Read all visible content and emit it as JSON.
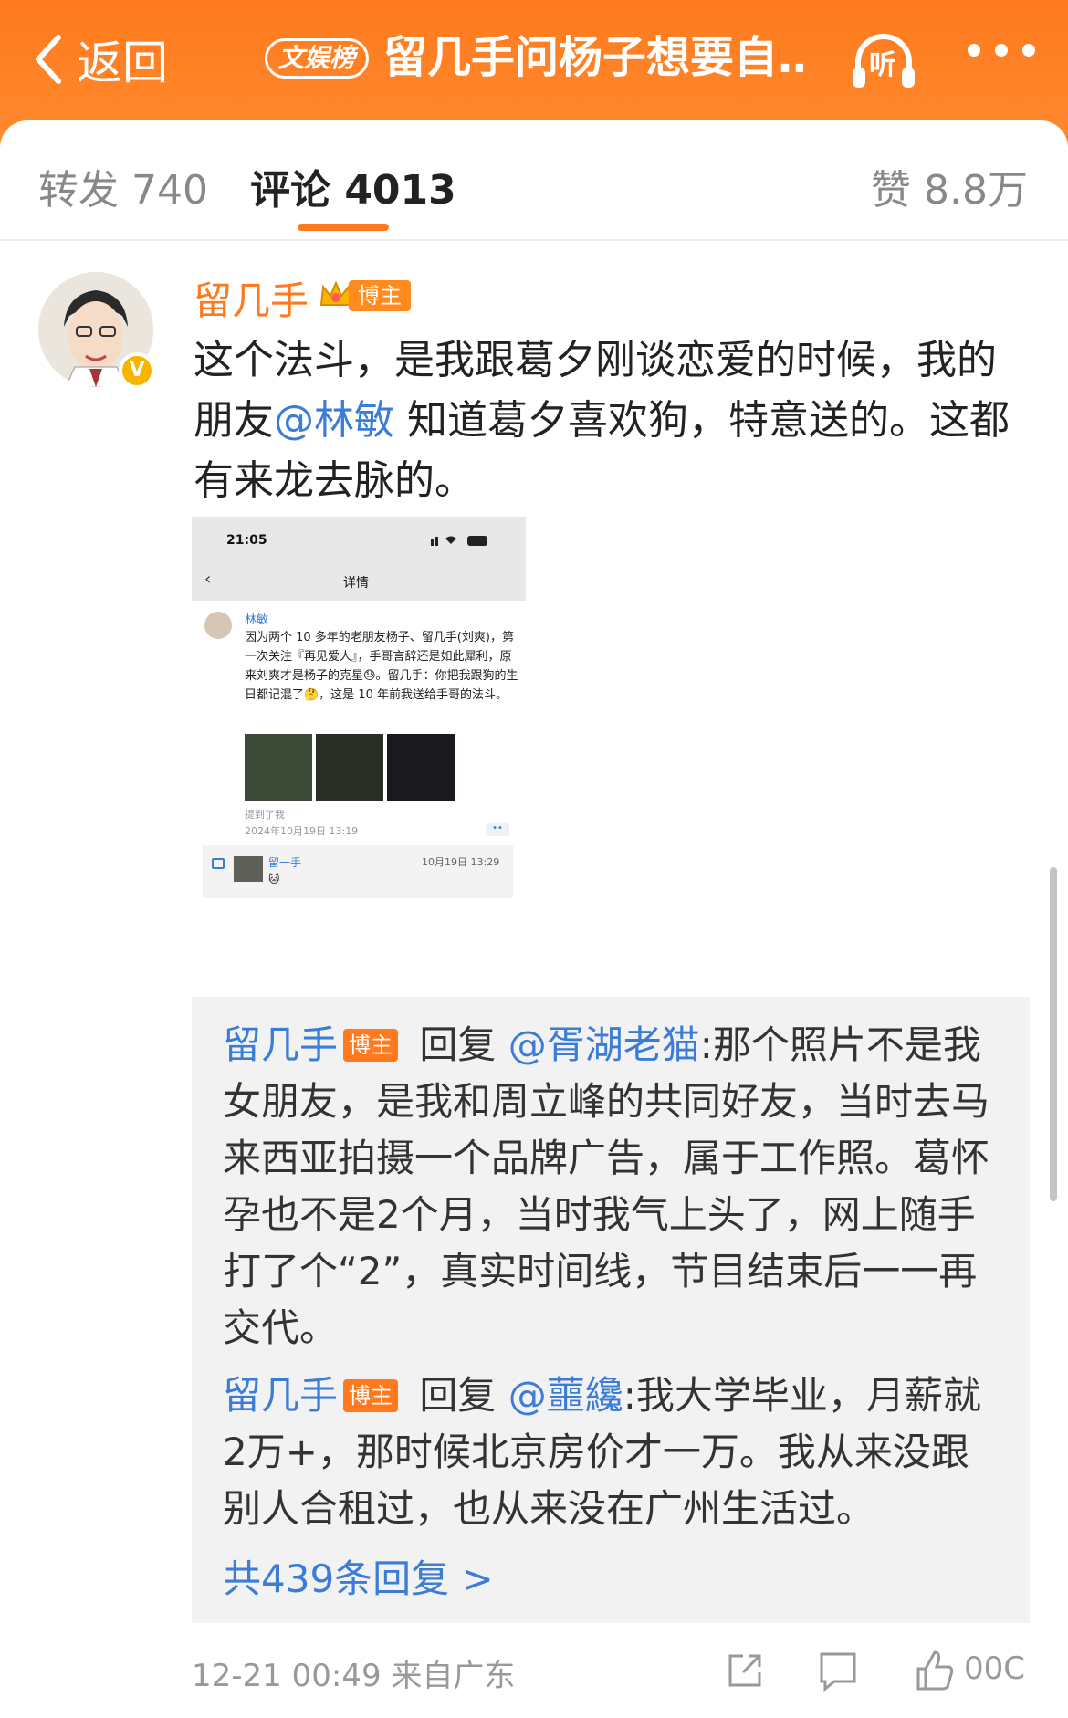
{
  "header": {
    "back_label": "返回",
    "tag": "文娱榜",
    "title": "留几手问杨子想要自…",
    "listen": "听",
    "bg_color": "#ff7a1e"
  },
  "tabs": {
    "repost": "转发 740",
    "comments": "评论 4013",
    "likes": "赞 8.8万"
  },
  "comment": {
    "author": "留几手",
    "badge": "博主",
    "text_part1": "这个法斗，是我跟葛夕刚谈恋爱的时候，我的朋友",
    "mention": "@林敏",
    "text_part2": " 知道葛夕喜欢狗，特意送的。这都有来龙去脉的。",
    "verified_icon": "verified-v-icon"
  },
  "embedded_shot": {
    "time": "21:05",
    "title": "详情",
    "name": "林敏",
    "text": "因为两个 10 多年的老朋友杨子、留几手(刘爽)，第一次关注『再见爱人』，手哥言辞还是如此犀利，原来刘爽才是杨子的克星😓。留几手：你把我跟狗的生日都记混了🤔，这是 10 年前我送给手哥的法斗。",
    "mentioned": "提到了我",
    "date": "2024年10月19日 13:19",
    "reply_name": "留一手",
    "reply_time": "10月19日 13:29",
    "reply_emoji": "🐱"
  },
  "replies": [
    {
      "author": "留几手",
      "badge": "博主",
      "reply_word": " 回复 ",
      "target": "@胥湖老猫",
      "text": ":那个照片不是我女朋友，是我和周立峰的共同好友，当时去马来西亚拍摄一个品牌广告，属于工作照。葛怀孕也不是2个月，当时我气上头了，网上随手打了个“2”，真实时间线，节目结束后一一再交代。"
    },
    {
      "author": "留几手",
      "badge": "博主",
      "reply_word": " 回复 ",
      "target": "@蘁纔",
      "text": ":我大学毕业，月薪就2万+，那时候北京房价才一万。我从来没跟别人合租过，也从来没在广州生活过。"
    }
  ],
  "more_replies": "共439条回复 >",
  "footer": {
    "meta": "12-21 00:49 来自广东",
    "actions": [
      "share-icon",
      "comment-icon",
      "like-icon"
    ],
    "like_count_partial": "00C"
  }
}
